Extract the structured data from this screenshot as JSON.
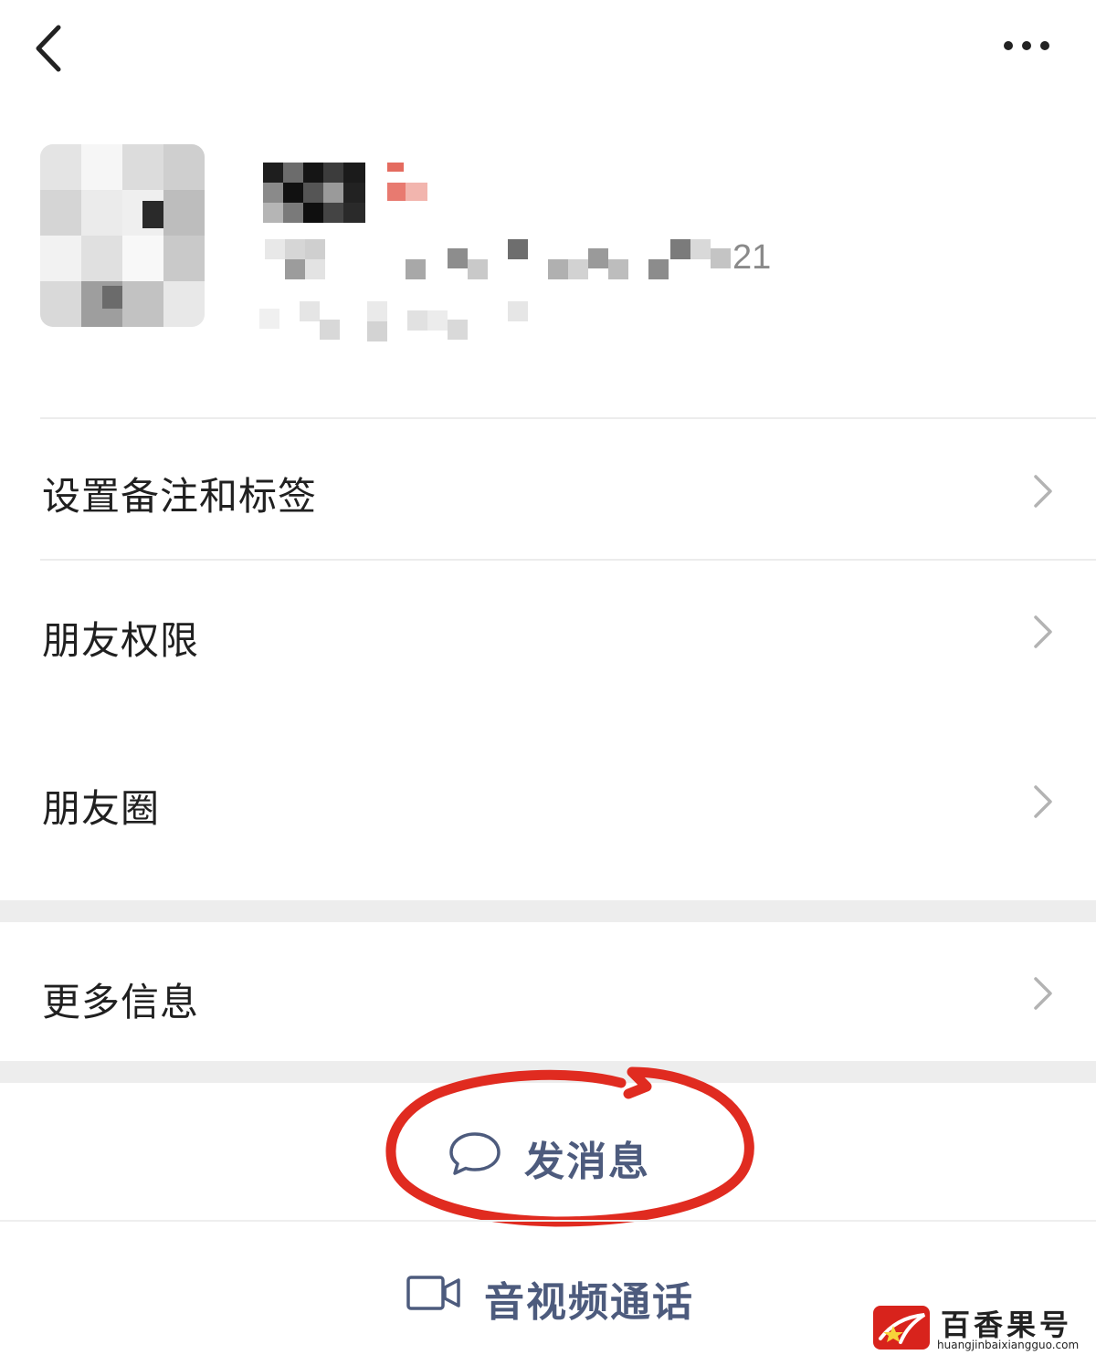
{
  "header": {
    "back_icon": "chevron-left-icon",
    "more_icon": "more-horizontal-icon"
  },
  "profile": {
    "avatar_note": "",
    "mosaic_visible_suffix": "21"
  },
  "menu": {
    "items": [
      {
        "label": "设置备注和标签",
        "icon": "chevron-right-icon"
      },
      {
        "label": "朋友权限",
        "icon": "chevron-right-icon"
      },
      {
        "label": "朋友圈",
        "icon": "chevron-right-icon"
      },
      {
        "label": "更多信息",
        "icon": "chevron-right-icon"
      }
    ]
  },
  "actions": {
    "send_message": {
      "label": "发消息",
      "icon": "chat-bubble-icon"
    },
    "video_call": {
      "label": "音视频通话",
      "icon": "video-camera-icon"
    }
  },
  "watermark": {
    "name": "百香果号",
    "url": "huangjinbaixiangguo.com"
  },
  "colors": {
    "action_text": "#4d5b7d",
    "annotation_circle": "#e02b20",
    "gap_background": "#ededed",
    "chevron": "#b3b3b3"
  }
}
